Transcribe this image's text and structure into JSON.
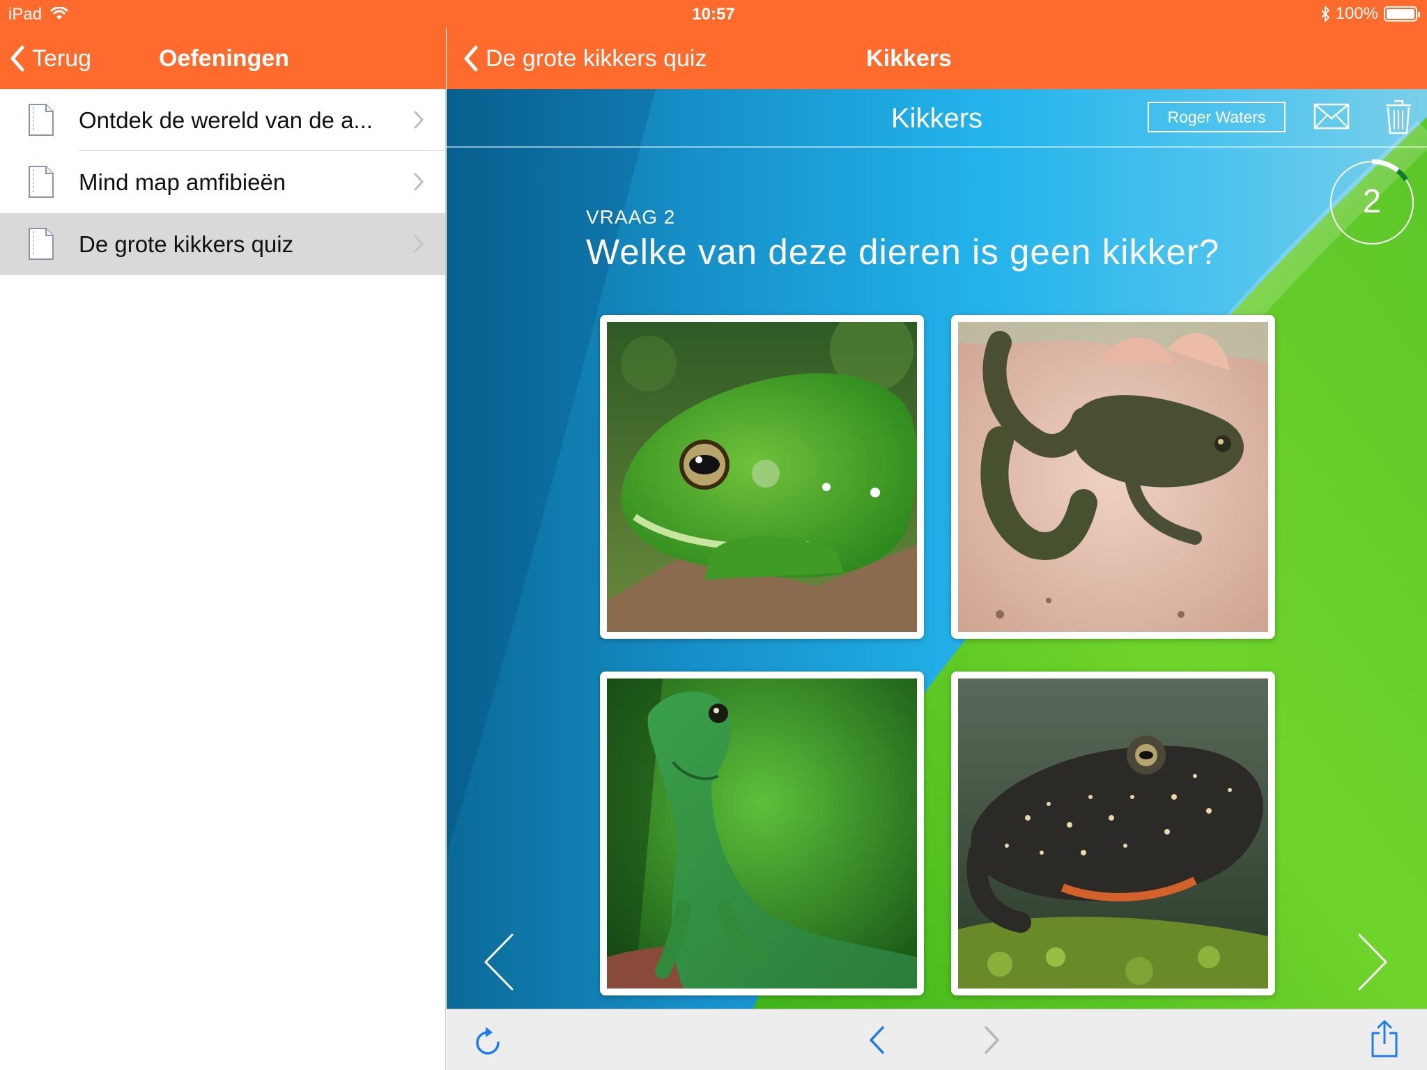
{
  "status_bar": {
    "carrier": "iPad",
    "time": "10:57",
    "battery": "100%",
    "battery_level": 1.0
  },
  "left_panel": {
    "nav": {
      "back_label": "Terug",
      "title": "Oefeningen"
    },
    "items": [
      {
        "label": "Ontdek de wereld van de a...",
        "selected": false
      },
      {
        "label": "Mind map amfibieën",
        "selected": false
      },
      {
        "label": "De grote kikkers quiz",
        "selected": true
      }
    ]
  },
  "right_panel": {
    "nav": {
      "back_label": "De grote kikkers quiz",
      "title": "Kikkers"
    },
    "header": {
      "title": "Kikkers",
      "user": "Roger Waters"
    },
    "timer": {
      "value": "2"
    },
    "question": {
      "number_label": "VRAAG 2",
      "text": "Welke van deze dieren is geen kikker?"
    },
    "answers": [
      {
        "icon": "green-tree-frog-photo"
      },
      {
        "icon": "brown-frog-in-hand-photo"
      },
      {
        "icon": "green-lizard-photo"
      },
      {
        "icon": "spotted-toad-photo"
      }
    ]
  },
  "colors": {
    "accent": "#FF6B2C",
    "selected_row": "#D9D9D9",
    "toolbar_icon": "#1E7CF2"
  }
}
